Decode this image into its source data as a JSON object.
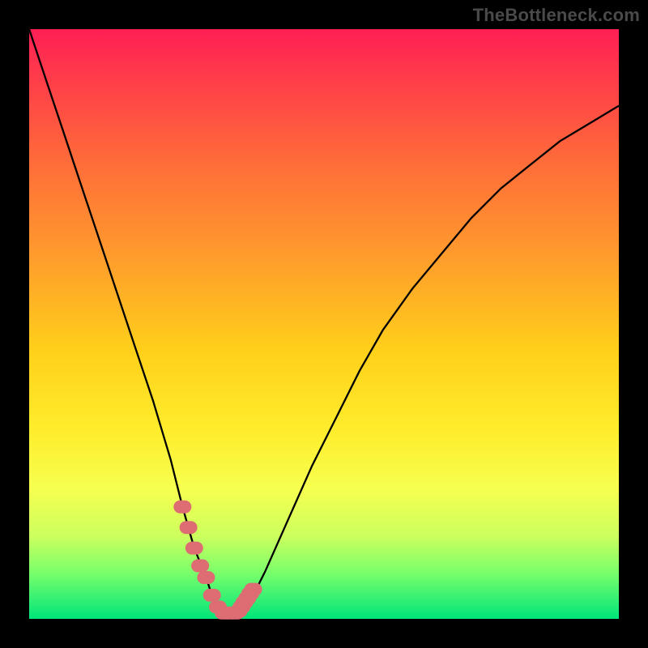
{
  "attribution": "TheBottleneck.com",
  "chart_data": {
    "type": "line",
    "title": "",
    "xlabel": "",
    "ylabel": "",
    "xlim": [
      0,
      100
    ],
    "ylim": [
      0,
      100
    ],
    "x": [
      0,
      3,
      6,
      9,
      12,
      15,
      18,
      21,
      24,
      26,
      28,
      30,
      31,
      32,
      33,
      34,
      36,
      38,
      40,
      44,
      48,
      52,
      56,
      60,
      65,
      70,
      75,
      80,
      85,
      90,
      95,
      100
    ],
    "values": [
      100,
      91,
      82,
      73,
      64,
      55,
      46,
      37,
      27,
      19,
      12,
      7,
      4,
      2,
      1,
      1,
      2,
      4,
      8,
      17,
      26,
      34,
      42,
      49,
      56,
      62,
      68,
      73,
      77,
      81,
      84,
      87
    ],
    "marker_points": {
      "x": [
        26,
        27,
        28,
        29,
        30,
        31,
        32,
        33,
        34,
        35,
        35.5,
        36,
        36.5,
        37,
        37.5,
        38
      ],
      "y": [
        19,
        15.5,
        12,
        9,
        7,
        4,
        2,
        1,
        1,
        1,
        1.3,
        2,
        2.8,
        3.5,
        4.3,
        5
      ]
    },
    "colors": {
      "curve": "#000000",
      "markers": "#dd6d73",
      "background_top": "#ff1f55",
      "background_bottom": "#00e57a"
    }
  }
}
